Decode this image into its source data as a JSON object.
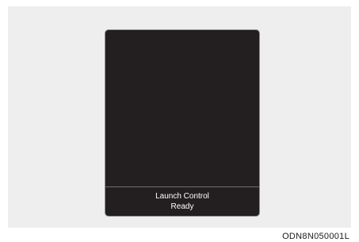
{
  "display": {
    "status_line_1": "Launch Control",
    "status_line_2": "Ready"
  },
  "figure_code": "ODN8N050001L",
  "colors": {
    "page_background": "#ffffff",
    "panel_background": "#eeeeee",
    "screen_background": "#231f20",
    "screen_border": "#8e8e8e",
    "status_text": "#ffffff"
  }
}
